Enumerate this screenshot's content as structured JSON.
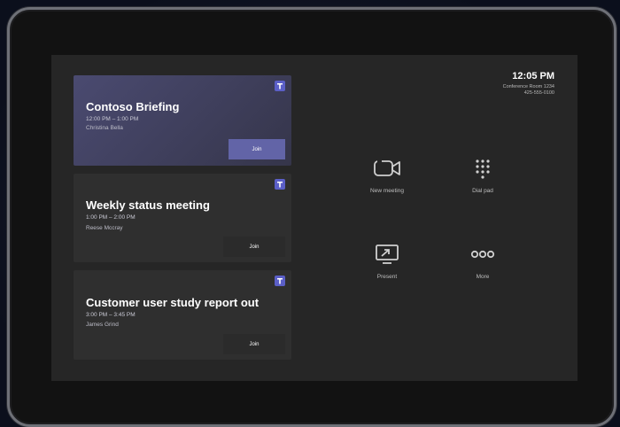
{
  "clock": {
    "time": "12:05 PM",
    "room": "Conference Room 1234",
    "number": "425-555-0100"
  },
  "meetings": [
    {
      "title": "Contoso Briefing",
      "time": "12:00 PM – 1:00 PM",
      "organizer": "Christina Bella",
      "join": "Join",
      "active": true
    },
    {
      "title": "Weekly status meeting",
      "time": "1:00 PM – 2:00 PM",
      "organizer": "Reese Mccray",
      "join": "Join",
      "active": false
    },
    {
      "title": "Customer user study report out",
      "time": "3:00 PM – 3:45 PM",
      "organizer": "James Grind",
      "join": "Join",
      "active": false
    }
  ],
  "actions": {
    "new_meeting": "New meeting",
    "dial_pad": "Dial pad",
    "present": "Present",
    "more": "More"
  },
  "colors": {
    "accent": "#6264a7",
    "screen_bg": "#262626",
    "card_bg": "#2f2f2f"
  },
  "icons": [
    "teams-icon",
    "video-camera-icon",
    "dial-pad-icon",
    "present-screen-icon",
    "more-icon"
  ]
}
